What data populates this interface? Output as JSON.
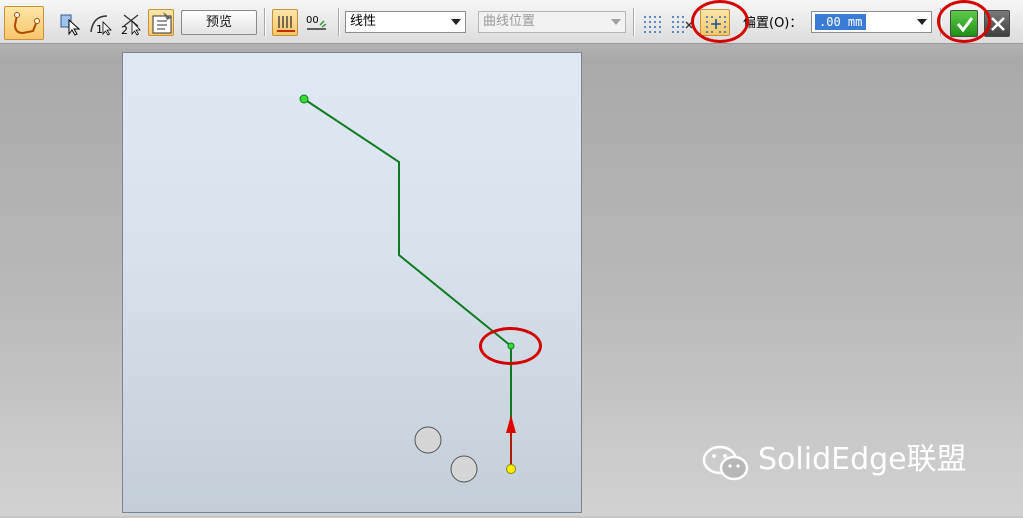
{
  "toolbar": {
    "preview_label": "预览",
    "curve_type": "线性",
    "curve_position_placeholder": "曲线位置",
    "offset_label": "偏置(O)：",
    "offset_value": ".00 mm",
    "accept_icon": "checkmark-icon",
    "cancel_icon": "close-icon"
  },
  "watermark": {
    "text": "SolidEdge联盟",
    "icon": "wechat-icon"
  },
  "colors": {
    "path": "#0e7a1f",
    "highlight": "#d40000",
    "accent": "#f7c66b"
  }
}
